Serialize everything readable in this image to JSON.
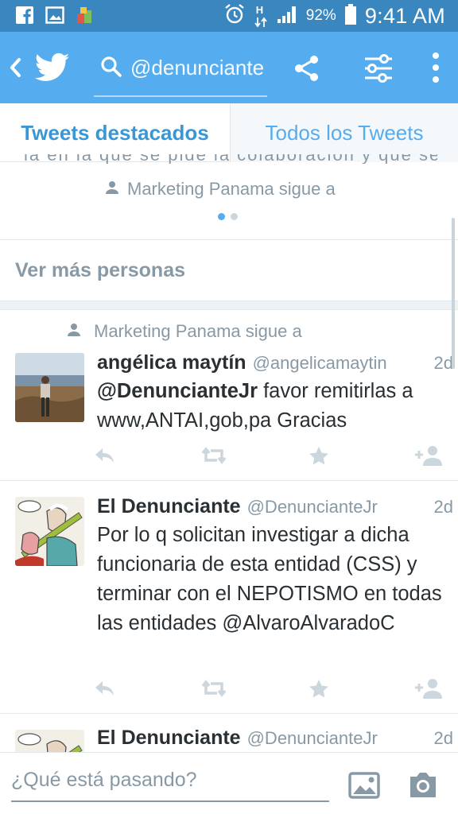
{
  "status_bar": {
    "battery": "92%",
    "time": "9:41 AM",
    "network_letter": "H",
    "icons": [
      "facebook-icon",
      "gallery-icon",
      "app-icon",
      "alarm-icon",
      "data-arrows-icon",
      "signal-icon",
      "battery-icon"
    ]
  },
  "app_bar": {
    "search_value": "@denunciante",
    "color": "#55acee",
    "icons": [
      "back-icon",
      "twitter-bird-icon",
      "search-icon",
      "share-icon",
      "filter-icon",
      "more-icon"
    ]
  },
  "tabs": [
    {
      "label": "Tweets destacados",
      "active": true
    },
    {
      "label": "Todos los Tweets",
      "active": false
    }
  ],
  "carousel": {
    "partial_text": "la en la que se pide la colaboración y que se debe",
    "context": "Marketing Panama sigue a",
    "page_count": 2,
    "active_page": 1
  },
  "see_more": "Ver más personas",
  "tweets": [
    {
      "context": "Marketing Panama sigue a",
      "name": "angélica maytín",
      "handle": "@angelicamaytin",
      "time": "2d",
      "mention": "@DenuncianteJr",
      "text": " favor remitirlas a www,ANTAI,gob,pa Gracias"
    },
    {
      "name": "El Denunciante",
      "handle": "@DenuncianteJr",
      "time": "2d",
      "text": "Por lo q solicitan investigar a dicha funcionaria de esta entidad (CSS) y terminar con el NEPOTISMO en todas las entidades @AlvaroAlvaradoC"
    },
    {
      "name": "El Denunciante",
      "handle": "@DenuncianteJr",
      "time": "2d"
    }
  ],
  "compose": {
    "placeholder": "¿Qué está pasando?"
  },
  "colors": {
    "accent": "#55acee",
    "status_bar": "#3a86bf",
    "muted": "#8899a6",
    "text": "#292f33"
  }
}
